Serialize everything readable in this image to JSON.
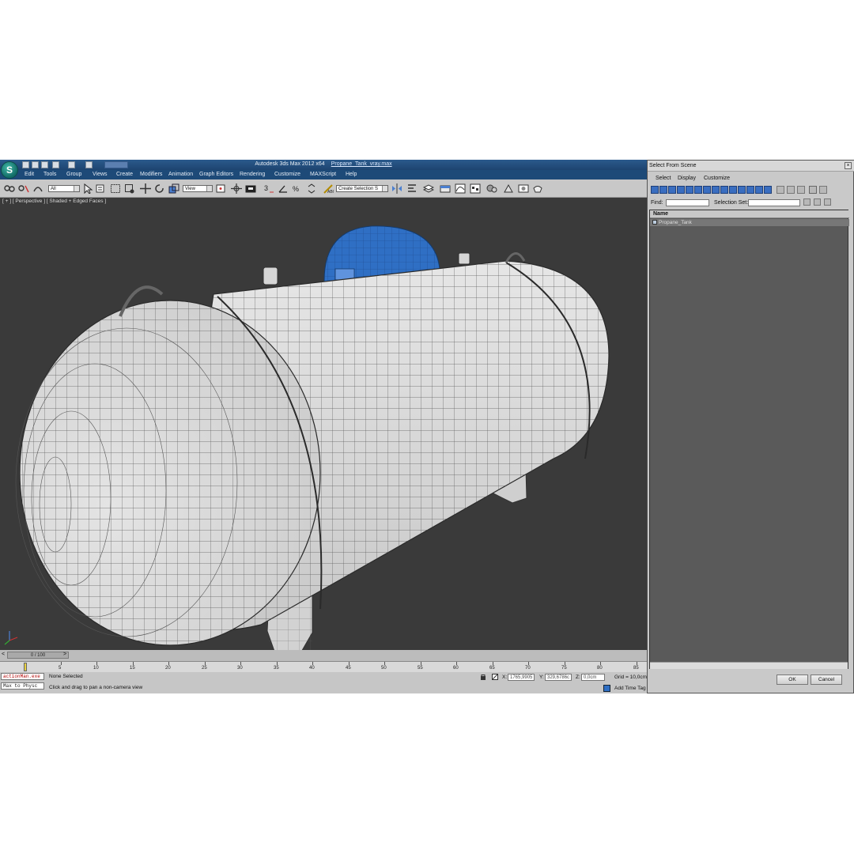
{
  "app": {
    "title": "Autodesk 3ds Max  2012 x64",
    "filename": "Propane_Tank_vray.max",
    "logo_letter": "S"
  },
  "menu": [
    "Edit",
    "Tools",
    "Group",
    "Views",
    "Create",
    "Modifiers",
    "Animation",
    "Graph Editors",
    "Rendering",
    "Customize",
    "MAXScript",
    "Help"
  ],
  "toolbar": {
    "filter_value": "All",
    "refcoord_value": "View",
    "selection_set_value": "Create Selection S"
  },
  "viewport": {
    "label": "[ + ] [ Perspective ] [ Shaded + Edged Faces ]",
    "bg_color": "#3a3a3a",
    "selected_color": "#2f6fc4"
  },
  "timeline": {
    "slider": "0 / 100",
    "prev": "<",
    "next": ">",
    "ticks": [
      "5",
      "10",
      "15",
      "20",
      "25",
      "30",
      "35",
      "40",
      "45",
      "50",
      "55",
      "60",
      "65",
      "70",
      "75",
      "80",
      "85"
    ]
  },
  "status": {
    "listener1": "actionMan.exe",
    "listener2": "Max to Physc",
    "selection": "None Selected",
    "prompt": "Click and drag to pan a non-camera view",
    "x_label": "X:",
    "x_value": "1765,9905",
    "y_label": "Y:",
    "y_value": "329,6786c",
    "z_label": "Z:",
    "z_value": "0,0cm",
    "grid": "Grid = 10,0cm",
    "add_time_tag": "Add Time Tag"
  },
  "dialog": {
    "title": "Select From Scene",
    "menu": [
      "Select",
      "Display",
      "Customize"
    ],
    "find_label": "Find:",
    "selection_set_label": "Selection Set:",
    "list_header": "Name",
    "items": [
      "Propane_Tank"
    ],
    "ok": "OK",
    "cancel": "Cancel"
  }
}
